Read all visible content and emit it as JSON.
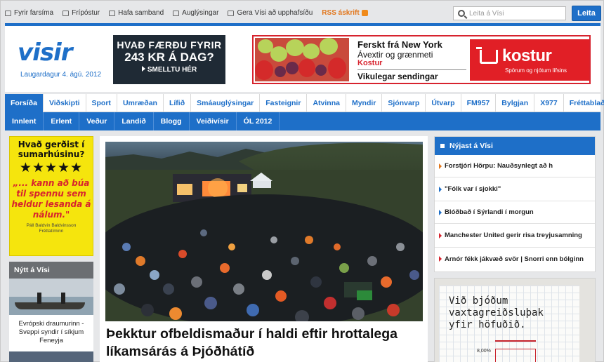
{
  "topbar": {
    "links": [
      {
        "label": "Fyrir farsíma",
        "icon": "mobile-icon"
      },
      {
        "label": "Frípóstur",
        "icon": "mail-icon"
      },
      {
        "label": "Hafa samband",
        "icon": "chat-icon"
      },
      {
        "label": "Auglýsingar",
        "icon": "briefcase-icon"
      },
      {
        "label": "Gera Vísi að upphafsíðu",
        "icon": "home-icon"
      }
    ],
    "rss_label": "RSS áskrift",
    "search_placeholder": "Leita á Vísi",
    "search_button": "Leita"
  },
  "header": {
    "logo_text": "visir",
    "date": "Laugardagur 4. ágú. 2012",
    "ad1": {
      "line1": "HVAÐ FÆRÐU FYRIR",
      "line2": "243 KR Á DAG?",
      "line3": "SMELLTU HÉR"
    },
    "ad2": {
      "line1": "Ferskt frá New York",
      "line2": "Ávextir og grænmeti",
      "line3": "Kostur",
      "line4": "Vikulegar sendingar",
      "brand": "kostur",
      "tagline": "Spörum og njótum lífsins"
    }
  },
  "nav_primary": [
    "Forsíða",
    "Viðskipti",
    "Sport",
    "Umræðan",
    "Lífið",
    "Smáauglýsingar",
    "Fasteignir",
    "Atvinna",
    "Myndir",
    "Sjónvarp",
    "Útvarp",
    "FM957",
    "Bylgjan",
    "X977",
    "Fréttablaðið"
  ],
  "nav_primary_active": 0,
  "nav_secondary": [
    "Innlent",
    "Erlent",
    "Veður",
    "Landið",
    "Blogg",
    "Veiðivísir",
    "ÓL 2012"
  ],
  "left_ad": {
    "question": "Hvað gerðist í sumarhúsinu?",
    "stars": "★★★★★",
    "quote": "„... kann að búa til spennu sem heldur lesanda á nálum.\"",
    "signature": "Páll Baldvin Baldvinsson\nFréttatíminn"
  },
  "nytt": {
    "title": "Nýtt á Vísi",
    "caption": "Evrópski draumurinn - Sveppi syndir í síkjum Feneyja"
  },
  "main": {
    "headline": "Þekktur ofbeldismaður í haldi eftir hrottalega líkamsárás á Þjóðhátíð",
    "photo_alt": "Crowd at Þjóðhátíð festival stage"
  },
  "nyjast": {
    "title": "Nýjast á Vísi",
    "items": [
      {
        "text": "Forstjóri Hörpu: Nauðsynlegt að h",
        "color": "orange"
      },
      {
        "text": "\"Fólk var í sjokki\"",
        "color": "blue"
      },
      {
        "text": "Blóðbað í Sýrlandi í morgun",
        "color": "blue"
      },
      {
        "text": "Manchester United gerir risa treyjusamning",
        "color": "red"
      },
      {
        "text": "Arnór fékk jákvæð svör | Snorri enn bólginn",
        "color": "red"
      }
    ]
  },
  "right_ad": {
    "text": "Við bjóðum vaxtagreiðsluþak yfir höfuðið.",
    "percent": "8,00%"
  },
  "colors": {
    "brand_blue": "#1e6fc8",
    "accent_red": "#d7232e",
    "rss_orange": "#e2761b"
  }
}
